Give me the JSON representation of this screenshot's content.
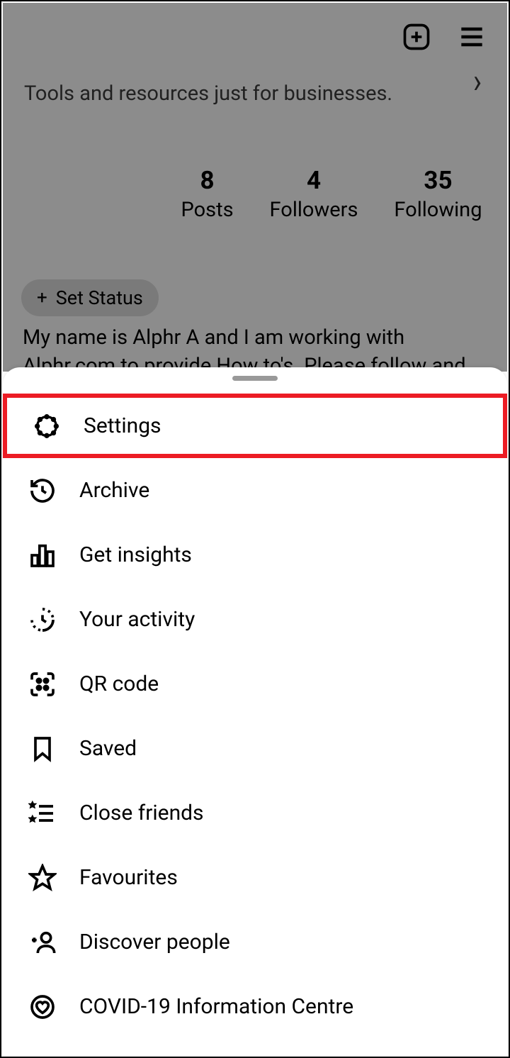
{
  "banner": {
    "text": "Tools and resources just for businesses."
  },
  "stats": {
    "posts": {
      "value": "8",
      "label": "Posts"
    },
    "followers": {
      "value": "4",
      "label": "Followers"
    },
    "following": {
      "value": "35",
      "label": "Following"
    }
  },
  "status_chip": {
    "label": "Set Status"
  },
  "bio": "My name is Alphr A and I am working with Alphr.com to provide How to's. Please follow and subscribe our",
  "menu": {
    "settings": "Settings",
    "archive": "Archive",
    "insights": "Get insights",
    "activity": "Your activity",
    "qr": "QR code",
    "saved": "Saved",
    "close_friends": "Close friends",
    "favourites": "Favourites",
    "discover": "Discover people",
    "covid": "COVID-19 Information Centre"
  }
}
